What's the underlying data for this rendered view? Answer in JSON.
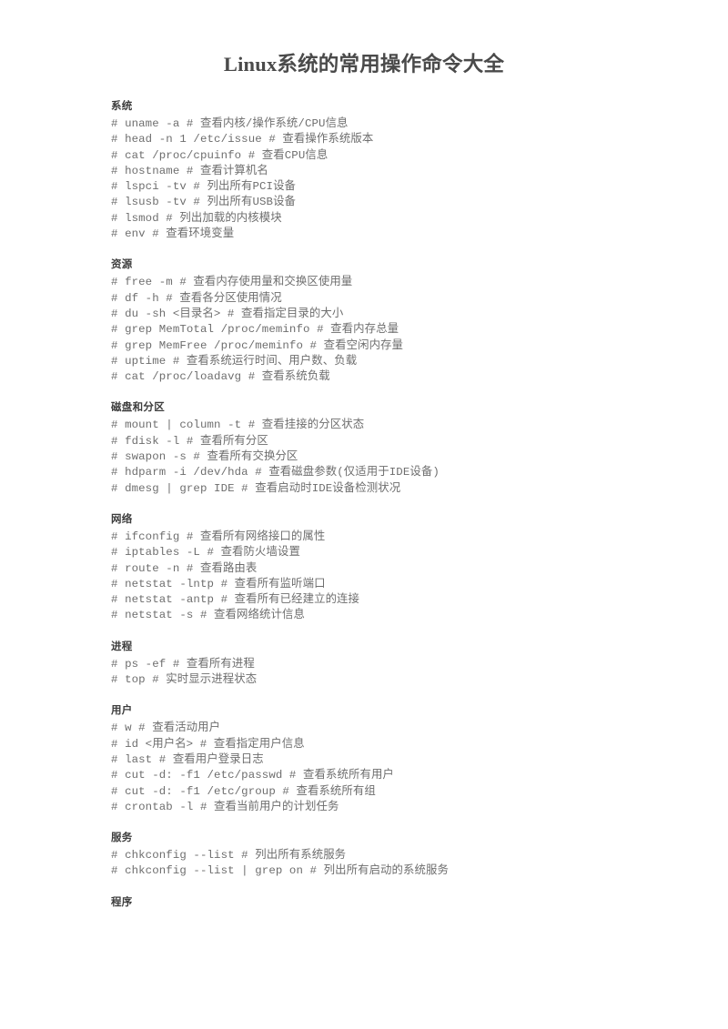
{
  "document": {
    "title": "Linux系统的常用操作命令大全"
  },
  "sections": [
    {
      "heading": "系统",
      "lines": [
        "# uname -a # 查看内核/操作系统/CPU信息",
        "# head -n 1 /etc/issue # 查看操作系统版本",
        "# cat /proc/cpuinfo # 查看CPU信息",
        "# hostname # 查看计算机名",
        "# lspci -tv # 列出所有PCI设备",
        "# lsusb -tv # 列出所有USB设备",
        "# lsmod # 列出加载的内核模块",
        "# env # 查看环境变量"
      ]
    },
    {
      "heading": "资源",
      "lines": [
        "# free -m # 查看内存使用量和交换区使用量",
        "# df -h # 查看各分区使用情况",
        "# du -sh <目录名> # 查看指定目录的大小",
        "# grep MemTotal /proc/meminfo # 查看内存总量",
        "# grep MemFree /proc/meminfo # 查看空闲内存量",
        "# uptime # 查看系统运行时间、用户数、负载",
        "# cat /proc/loadavg # 查看系统负载"
      ]
    },
    {
      "heading": "磁盘和分区",
      "lines": [
        "# mount | column -t # 查看挂接的分区状态",
        "# fdisk -l # 查看所有分区",
        "# swapon -s # 查看所有交换分区",
        "# hdparm -i /dev/hda # 查看磁盘参数(仅适用于IDE设备)",
        "# dmesg | grep IDE # 查看启动时IDE设备检测状况"
      ]
    },
    {
      "heading": "网络",
      "lines": [
        "# ifconfig # 查看所有网络接口的属性",
        "# iptables -L # 查看防火墙设置",
        "# route -n # 查看路由表",
        "# netstat -lntp # 查看所有监听端口",
        "# netstat -antp # 查看所有已经建立的连接",
        "# netstat -s # 查看网络统计信息"
      ]
    },
    {
      "heading": "进程",
      "lines": [
        "# ps -ef # 查看所有进程",
        "# top # 实时显示进程状态"
      ]
    },
    {
      "heading": "用户",
      "lines": [
        "# w # 查看活动用户",
        "# id <用户名> # 查看指定用户信息",
        "# last # 查看用户登录日志",
        "# cut -d: -f1 /etc/passwd # 查看系统所有用户",
        "# cut -d: -f1 /etc/group # 查看系统所有组",
        "# crontab -l # 查看当前用户的计划任务"
      ]
    },
    {
      "heading": "服务",
      "lines": [
        "# chkconfig --list # 列出所有系统服务",
        "# chkconfig --list | grep on # 列出所有启动的系统服务"
      ]
    },
    {
      "heading": "程序",
      "lines": []
    }
  ],
  "colors": {
    "page_background": "#ffffff",
    "title_text": "#4a4a4a",
    "heading_text": "#3d3d3d",
    "body_text": "#6e6e6e"
  }
}
